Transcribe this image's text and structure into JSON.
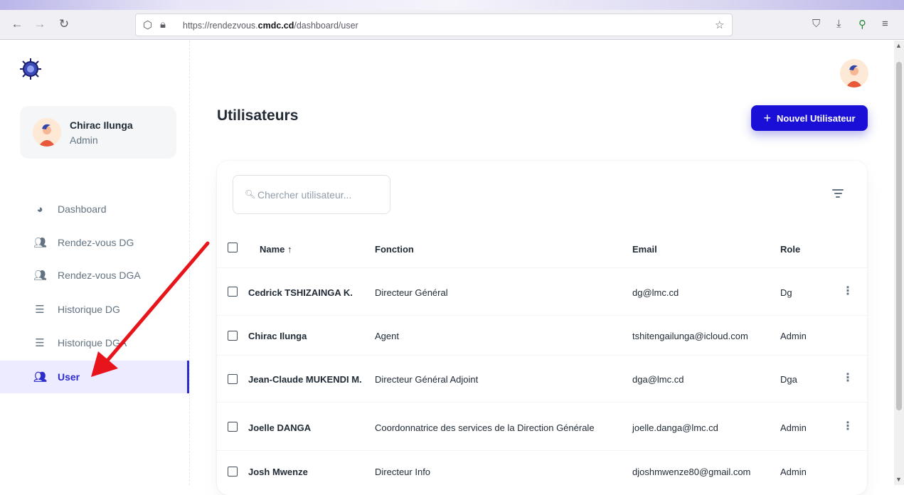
{
  "browser": {
    "url_prefix": "https://rendezvous.",
    "url_domain": "cmdc.cd",
    "url_path": "/dashboard/user"
  },
  "sidebar": {
    "account": {
      "name": "Chirac Ilunga",
      "role": "Admin"
    },
    "items": [
      {
        "label": "Dashboard",
        "icon": "pie-chart-icon"
      },
      {
        "label": "Rendez-vous DG",
        "icon": "people-icon"
      },
      {
        "label": "Rendez-vous DGA",
        "icon": "people-icon"
      },
      {
        "label": "Historique DG",
        "icon": "list-icon"
      },
      {
        "label": "Historique DGA",
        "icon": "list-icon"
      },
      {
        "label": "User",
        "icon": "people-icon",
        "active": true
      }
    ]
  },
  "main": {
    "title": "Utilisateurs",
    "new_button": "Nouvel Utilisateur",
    "search_placeholder": "Chercher utilisateur...",
    "columns": {
      "name": "Name",
      "fonction": "Fonction",
      "email": "Email",
      "role": "Role"
    },
    "rows": [
      {
        "name": "Cedrick TSHIZAINGA K.",
        "fonction": "Directeur Général",
        "email": "dg@lmc.cd",
        "role": "Dg",
        "menu": true
      },
      {
        "name": "Chirac Ilunga",
        "fonction": "Agent",
        "email": "tshitengailunga@icloud.com",
        "role": "Admin",
        "menu": false
      },
      {
        "name": "Jean-Claude MUKENDI M.",
        "fonction": "Directeur Général Adjoint",
        "email": "dga@lmc.cd",
        "role": "Dga",
        "menu": true
      },
      {
        "name": "Joelle DANGA",
        "fonction": "Coordonnatrice des services de la Direction Générale",
        "email": "joelle.danga@lmc.cd",
        "role": "Admin",
        "menu": true
      },
      {
        "name": "Josh Mwenze",
        "fonction": "Directeur Info",
        "email": "djoshmwenze80@gmail.com",
        "role": "Admin",
        "menu": false
      }
    ]
  },
  "colors": {
    "accent": "#1a0fd6",
    "active_bg": "#ecebff",
    "annotation": "#e8141b"
  }
}
